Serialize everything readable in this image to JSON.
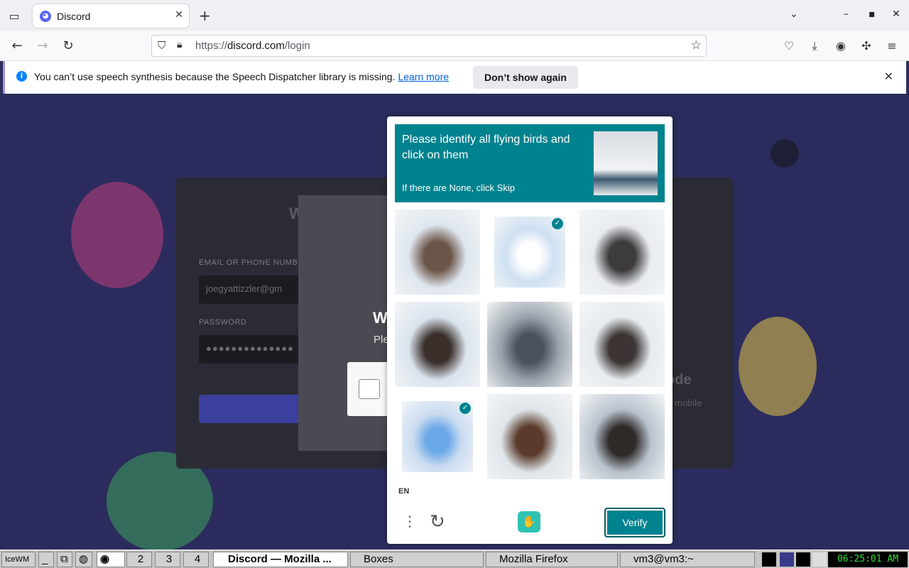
{
  "browser": {
    "tab_title": "Discord",
    "url_prefix": "https://",
    "url_domain": "discord.com",
    "url_path": "/login"
  },
  "notification": {
    "message": "You can’t use speech synthesis because the Speech Dispatcher library is missing.",
    "link": "Learn more",
    "button": "Don’t show again"
  },
  "login": {
    "email_label": "EMAIL OR PHONE NUMBER",
    "email_value": "joegyattizzler@gm",
    "password_label": "PASSWORD",
    "password_value": "●●●●●●●●●●●●●●",
    "partial_title": "W",
    "partial_subtitle": "Ple",
    "qr_partial": "ode",
    "qr_sub_partial": "mobile"
  },
  "captcha": {
    "prompt": "Please identify all flying birds and click on them",
    "sub": "If there are None, click Skip",
    "language": "EN",
    "verify_label": "Verify",
    "cells": [
      {
        "subject": "horse in snow",
        "selected": false,
        "colors": [
          "#dfe6ee",
          "#6b5548"
        ]
      },
      {
        "subject": "flying bird",
        "selected": true,
        "colors": [
          "#cfe0f2",
          "#ffffff"
        ]
      },
      {
        "subject": "raccoon in snow",
        "selected": false,
        "colors": [
          "#e8ecf0",
          "#3d3b3c"
        ]
      },
      {
        "subject": "raccoon in snow",
        "selected": false,
        "colors": [
          "#dbe4ee",
          "#3a2f2b"
        ]
      },
      {
        "subject": "blurred landscape",
        "selected": false,
        "colors": [
          "#9aa3ad",
          "#4a525c"
        ]
      },
      {
        "subject": "raccoon in snow",
        "selected": false,
        "colors": [
          "#e6ebf0",
          "#3c3533"
        ]
      },
      {
        "subject": "flying bird",
        "selected": true,
        "colors": [
          "#c9dbf0",
          "#6aa8e8"
        ]
      },
      {
        "subject": "horse running in snow",
        "selected": false,
        "colors": [
          "#dfe5ea",
          "#5a3a2a"
        ]
      },
      {
        "subject": "raccoon in snow",
        "selected": false,
        "colors": [
          "#b9c3ce",
          "#2f2a28"
        ]
      }
    ]
  },
  "taskbar": {
    "desktops": [
      "2",
      "3",
      "4"
    ],
    "windows": [
      "Discord — Mozilla ...",
      "Boxes",
      "Mozilla Firefox",
      "vm3@vm3:~"
    ],
    "clock": "06:25:01 AM"
  }
}
